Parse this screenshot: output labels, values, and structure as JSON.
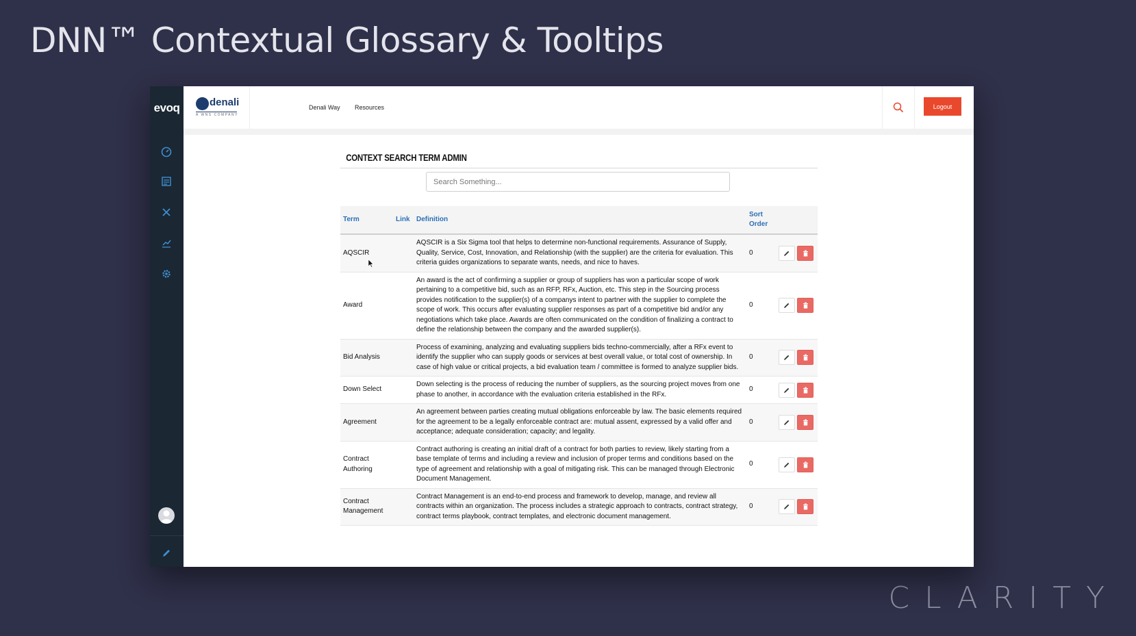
{
  "slide": {
    "title": "DNN™ Contextual Glossary & Tooltips",
    "brand": "CLARITY"
  },
  "rail": {
    "logo": "evoq",
    "icons": [
      "dashboard-icon",
      "content-icon",
      "tools-icon",
      "analytics-icon",
      "settings-icon"
    ],
    "bottom_icon": "pencil-icon",
    "color": "#1b2733"
  },
  "site": {
    "logo_word": "denali",
    "logo_sub": "A WNS COMPANY",
    "nav": [
      "Denali Way",
      "Resources"
    ],
    "logout_label": "Logout",
    "accent": "#e9482c"
  },
  "admin": {
    "title": "CONTEXT SEARCH TERM ADMIN",
    "search_placeholder": "Search Something...",
    "columns": {
      "term": "Term",
      "link": "Link",
      "definition": "Definition",
      "sort_order": "Sort Order"
    },
    "rows": [
      {
        "term": "AQSCIR",
        "definition": "AQSCIR is a Six Sigma tool that helps to determine non-functional requirements. Assurance of Supply, Quality, Service, Cost, Innovation, and Relationship (with the supplier) are the criteria for evaluation. This criteria guides organizations to separate wants, needs, and nice to haves.",
        "sort_order": "0"
      },
      {
        "term": "Award",
        "definition": "An award is the act of confirming a supplier or group of suppliers has won a particular scope of work pertaining to a competitive bid, such as an RFP, RFx, Auction, etc. This step in the Sourcing process provides notification to the supplier(s) of a companys intent to partner with the supplier to complete the scope of work. This occurs after evaluating supplier responses as part of a competitive bid and/or any negotiations which take place. Awards are often communicated on the condition of finalizing a contract to define the relationship between the company and the awarded supplier(s).",
        "sort_order": "0"
      },
      {
        "term": "Bid Analysis",
        "definition": "Process of examining, analyzing and evaluating suppliers bids techno-commercially, after a RFx event to identify the supplier who can supply goods or services at best overall value, or total cost of ownership. In case of high value or critical projects, a bid evaluation team / committee is formed to analyze supplier bids.",
        "sort_order": "0"
      },
      {
        "term": "Down Select",
        "definition": "Down selecting is the process of reducing the number of suppliers, as the sourcing project moves from one phase to another, in accordance with the evaluation criteria established in the RFx.",
        "sort_order": "0"
      },
      {
        "term": "Agreement",
        "definition": "An agreement between parties creating mutual obligations enforceable by law. The basic elements required for the agreement to be a legally enforceable contract are: mutual assent, expressed by a valid offer and acceptance; adequate consideration; capacity; and legality.",
        "sort_order": "0"
      },
      {
        "term": "Contract Authoring",
        "definition": "Contract authoring is creating an initial draft of a contract for both parties to review, likely starting from a base template of terms and including a review and inclusion of proper terms and conditions based on the type of agreement and relationship with a goal of mitigating risk. This can be managed through Electronic Document Management.",
        "sort_order": "0"
      },
      {
        "term": "Contract Management",
        "definition": "Contract Management is an end-to-end process and framework to develop, manage, and review all contracts within an organization. The process includes a strategic approach to contracts, contract strategy, contract terms playbook, contract templates, and electronic document management.",
        "sort_order": "0"
      }
    ]
  }
}
